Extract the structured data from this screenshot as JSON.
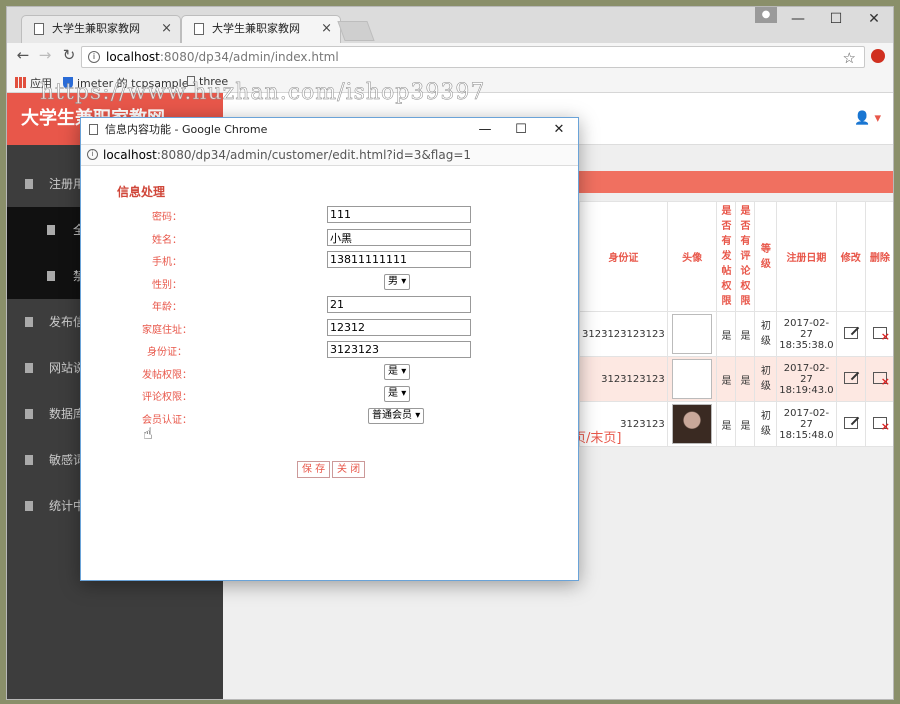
{
  "browser": {
    "tabs": [
      {
        "title": "大学生兼职家教网"
      },
      {
        "title": "大学生兼职家教网"
      }
    ],
    "url_host": "localhost",
    "url_path": ":8080/dp34/admin/index.html",
    "bookmarks": [
      "应用",
      "jmeter 的 tcpsample",
      "three"
    ],
    "window_controls": {
      "minimize": "—",
      "maximize": "☐",
      "close": "✕"
    }
  },
  "site": {
    "brand": "大学生兼职家教网",
    "watermark": "https://www.huzhan.com/ishop39397"
  },
  "sidebar": {
    "items": [
      {
        "label": "注册用"
      },
      {
        "label": "全"
      },
      {
        "label": "禁"
      },
      {
        "label": "发布信"
      },
      {
        "label": "网站说"
      },
      {
        "label": "数据库"
      },
      {
        "label": "敏感词"
      },
      {
        "label": "统计中"
      }
    ]
  },
  "table": {
    "headers": [
      "身份证",
      "头像",
      "是否有发帖权限",
      "是否有评论权限",
      "等级",
      "注册日期",
      "修改",
      "删除"
    ],
    "rows": [
      {
        "id": "3123123123123",
        "post": "是",
        "comment": "是",
        "level": "初级",
        "date": "2017-02-27 18:35:38.0"
      },
      {
        "id": "3123123123",
        "post": "是",
        "comment": "是",
        "level": "初级",
        "date": "2017-02-27 18:19:43.0"
      },
      {
        "id": "3123123",
        "post": "是",
        "comment": "是",
        "level": "初级",
        "date": "2017-02-27 18:15:48.0"
      }
    ],
    "pager": "页/末页]"
  },
  "popup": {
    "title": "信息内容功能 - Google Chrome",
    "url_host": "localhost",
    "url_path": ":8080/dp34/admin/customer/edit.html?id=3&flag=1",
    "form_title": "信息处理",
    "fields": {
      "password": {
        "label": "密码：",
        "value": "111"
      },
      "name": {
        "label": "姓名：",
        "value": "小黑"
      },
      "phone": {
        "label": "手机：",
        "value": "13811111111"
      },
      "gender": {
        "label": "性别：",
        "value": "男"
      },
      "age": {
        "label": "年龄：",
        "value": "21"
      },
      "address": {
        "label": "家庭住址：",
        "value": "12312"
      },
      "idcard": {
        "label": "身份证：",
        "value": "3123123"
      },
      "post_perm": {
        "label": "发帖权限：",
        "value": "是"
      },
      "comment_perm": {
        "label": "评论权限：",
        "value": "是"
      },
      "member": {
        "label": "会员认证：",
        "value": "普通会员"
      }
    },
    "save_label": "保 存",
    "close_label": "关 闭"
  }
}
